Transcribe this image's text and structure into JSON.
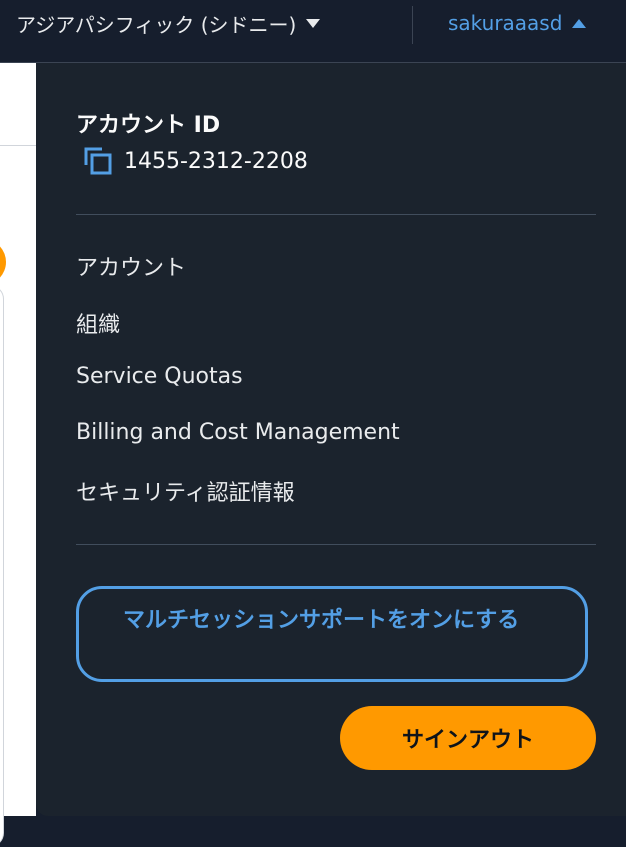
{
  "header": {
    "region_label": "アジアパシフィック (シドニー)",
    "username": "sakuraaasd"
  },
  "menu": {
    "account_id_title": "アカウント ID",
    "account_id_value": "1455-2312-2208",
    "items": [
      {
        "label": "アカウント"
      },
      {
        "label": "組織"
      },
      {
        "label": "Service Quotas"
      },
      {
        "label": "Billing and Cost Management"
      },
      {
        "label": "セキュリティ認証情報"
      }
    ],
    "multi_session_button": "マルチセッションサポートをオンにする",
    "sign_out_button": "サインアウト"
  },
  "colors": {
    "accent_blue": "#539fe5",
    "sign_out_orange": "#ff9900",
    "menu_background": "#1b232d"
  }
}
